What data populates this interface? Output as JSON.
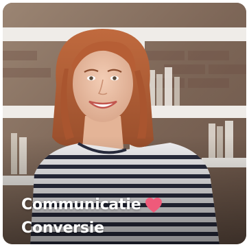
{
  "card": {
    "line1": "Communicatie",
    "line2": "Conversie",
    "icon": "heart-icon",
    "heart_color": "#ef5a7a"
  }
}
